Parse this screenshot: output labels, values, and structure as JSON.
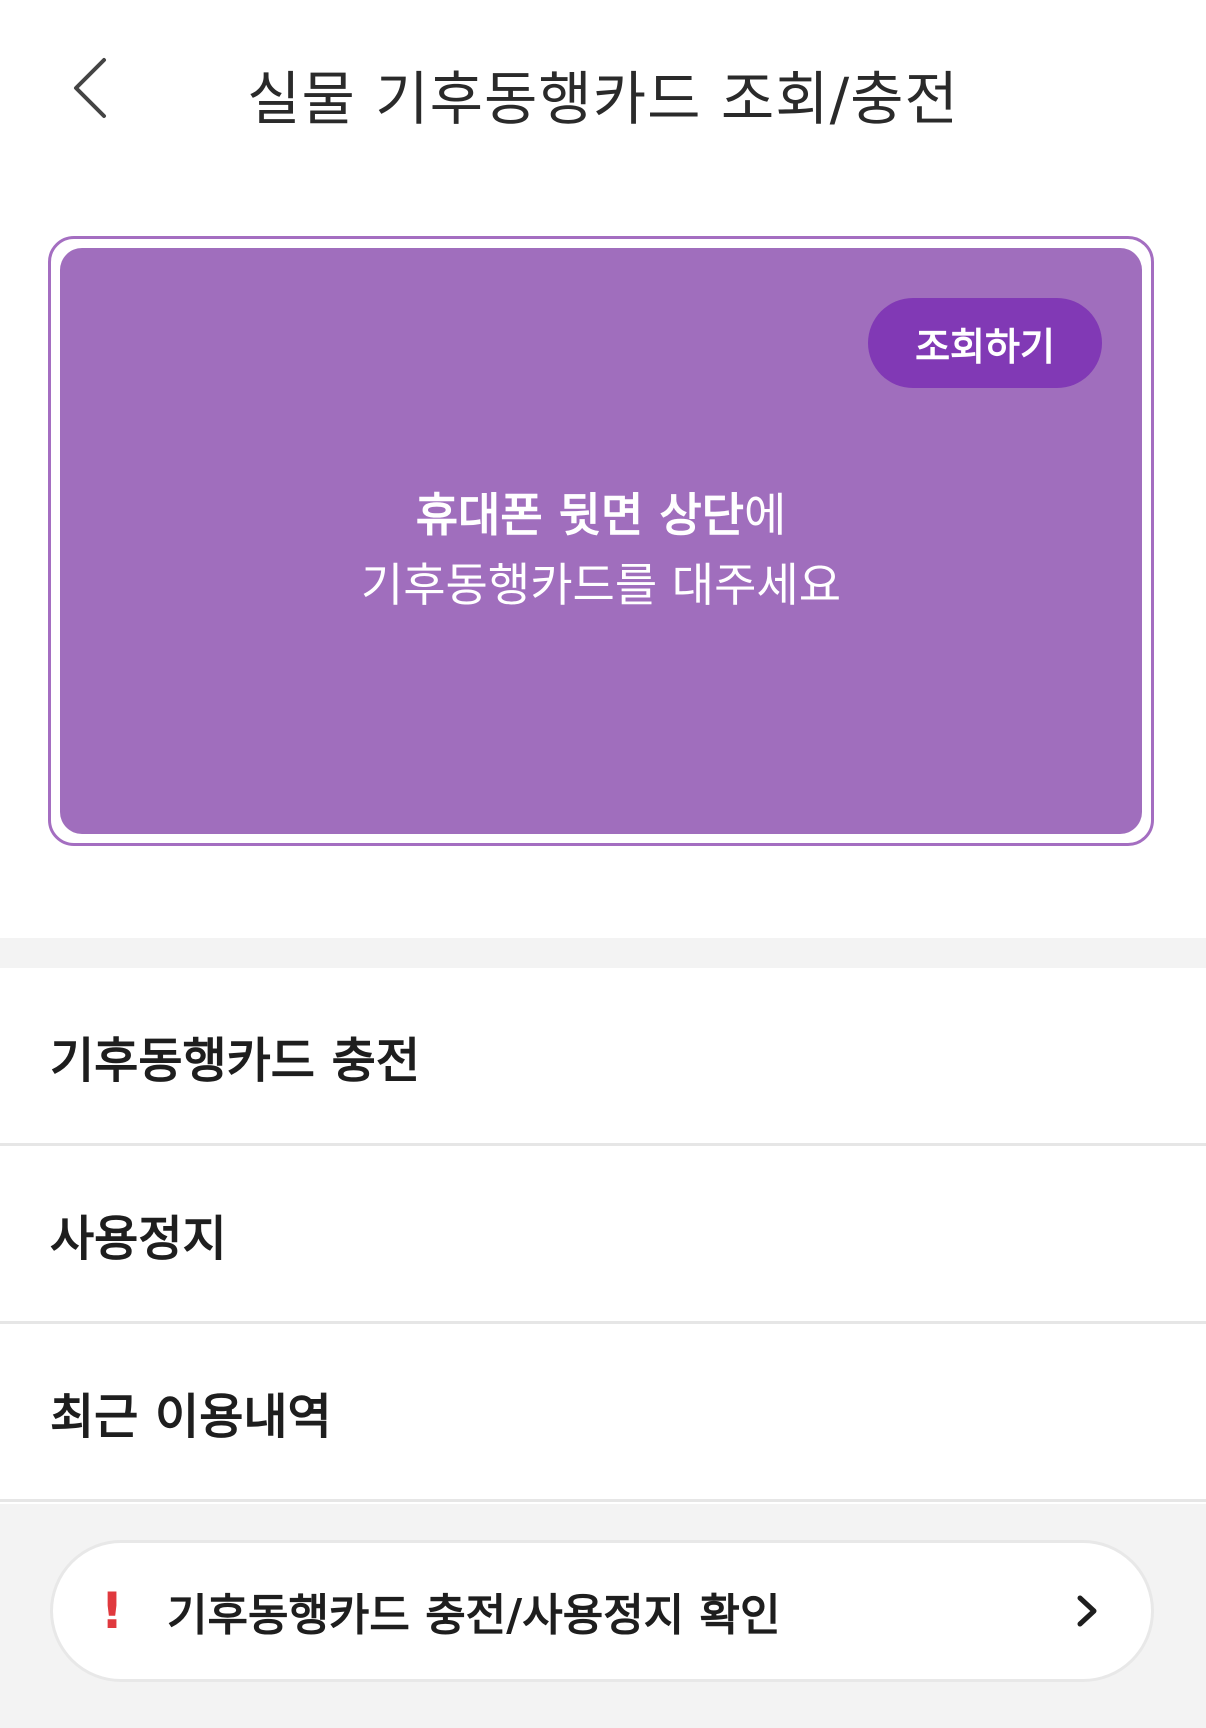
{
  "header": {
    "title": "실물 기후동행카드 조회/충전",
    "back_icon": "chevron-left-icon"
  },
  "card": {
    "inquiry_button": "조회하기",
    "instruction": {
      "line1_bold": "휴대폰 뒷면 상단",
      "line1_normal": "에",
      "line2": "기후동행카드를 대주세요"
    },
    "colors": {
      "card_bg": "#a06ebd",
      "border": "#a46ec1",
      "button_bg": "#8139b5"
    }
  },
  "menu": {
    "items": [
      {
        "label": "기후동행카드 충전"
      },
      {
        "label": "사용정지"
      },
      {
        "label": "최근 이용내역"
      }
    ]
  },
  "notice": {
    "alert_icon": "exclamation-icon",
    "text": "기후동행카드 충전/사용정지 확인",
    "chevron_icon": "chevron-right-icon",
    "alert_color": "#e0393e"
  }
}
